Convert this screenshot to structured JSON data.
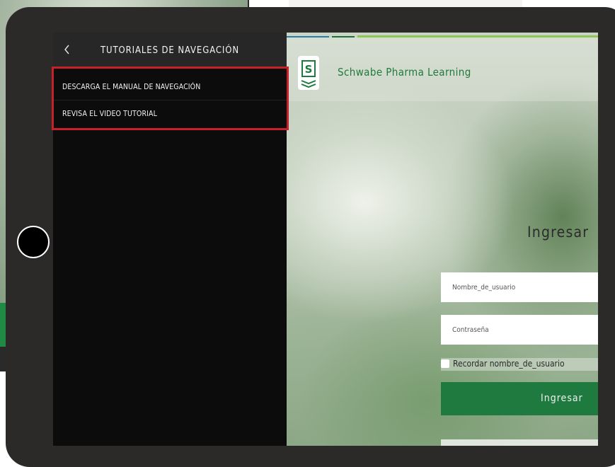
{
  "sidebar": {
    "title": "TUTORIALES DE NAVEGACIÓN",
    "back_icon": "chevron-left-icon",
    "items": [
      {
        "label": "DESCARGA EL MANUAL DE NAVEGACIÓN"
      },
      {
        "label": "REVISA EL VIDEO TUTORIAL"
      }
    ]
  },
  "header": {
    "brand": "Schwabe Pharma Learning",
    "logo_icon": "schwabe-logo-icon"
  },
  "login": {
    "title": "Ingresar",
    "username_placeholder": "Nombre_de_usuario",
    "password_placeholder": "Contraseña",
    "remember_label": "Recordar nombre_de_usuario",
    "submit_label": "Ingresar"
  },
  "colors": {
    "brand_green": "#1f7a3f",
    "highlight_red": "#c8202b",
    "sidebar_bg": "#0c0c0c",
    "tablet_frame": "#2b2a29"
  }
}
